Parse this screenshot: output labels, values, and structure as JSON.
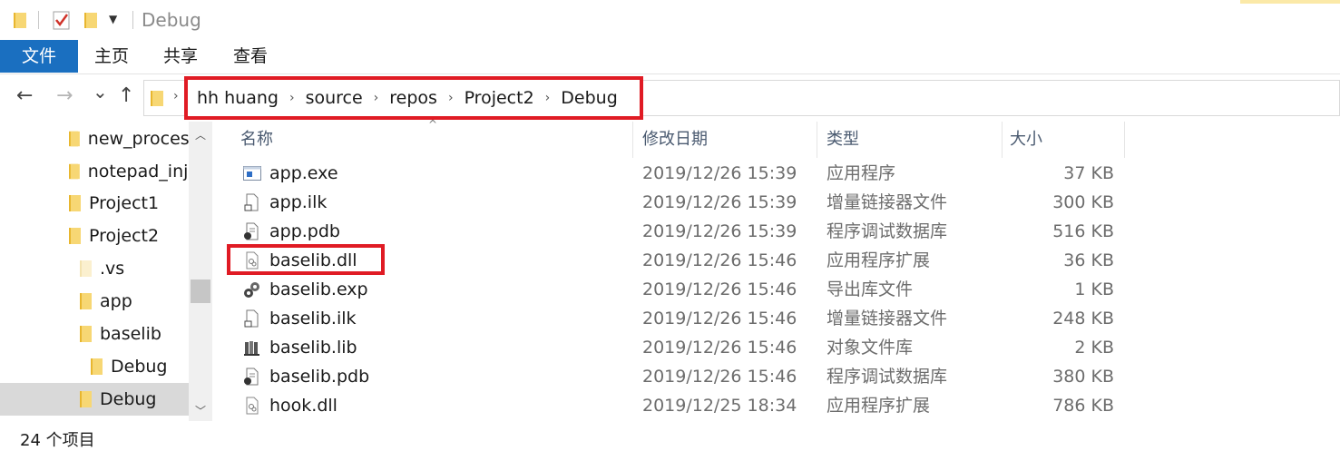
{
  "window": {
    "title": "Debug",
    "quick_access_icons": [
      "folder-icon",
      "properties-check-icon",
      "new-folder-icon",
      "customize-dropdown-icon"
    ]
  },
  "ribbon": {
    "tabs": [
      "文件",
      "主页",
      "共享",
      "查看"
    ],
    "active_tab_color": "#1a6fc0"
  },
  "nav": {
    "back": "←",
    "forward": "→",
    "recent": "⌄",
    "up": "↑",
    "breadcrumbs": [
      "hh huang",
      "source",
      "repos",
      "Project2",
      "Debug"
    ],
    "highlight_color": "#e01b24"
  },
  "tree": {
    "items": [
      {
        "label": "new_process"
      },
      {
        "label": "notepad_inje"
      },
      {
        "label": "Project1"
      },
      {
        "label": "Project2"
      },
      {
        "label": ".vs"
      },
      {
        "label": "app"
      },
      {
        "label": "baselib"
      },
      {
        "label": "Debug"
      },
      {
        "label": "Debug"
      }
    ],
    "selected_index": 8
  },
  "columns": {
    "name": "名称",
    "date": "修改日期",
    "type": "类型",
    "size": "大小"
  },
  "files": [
    {
      "name": "app.exe",
      "date": "2019/12/26 15:39",
      "type": "应用程序",
      "size": "37 KB",
      "icon": "exe-icon"
    },
    {
      "name": "app.ilk",
      "date": "2019/12/26 15:39",
      "type": "增量链接器文件",
      "size": "300 KB",
      "icon": "ilk-file-icon"
    },
    {
      "name": "app.pdb",
      "date": "2019/12/26 15:39",
      "type": "程序调试数据库",
      "size": "516 KB",
      "icon": "pdb-file-icon"
    },
    {
      "name": "baselib.dll",
      "date": "2019/12/26 15:46",
      "type": "应用程序扩展",
      "size": "36 KB",
      "icon": "dll-file-icon"
    },
    {
      "name": "baselib.exp",
      "date": "2019/12/26 15:46",
      "type": "导出库文件",
      "size": "1 KB",
      "icon": "exp-file-icon"
    },
    {
      "name": "baselib.ilk",
      "date": "2019/12/26 15:46",
      "type": "增量链接器文件",
      "size": "248 KB",
      "icon": "ilk-file-icon"
    },
    {
      "name": "baselib.lib",
      "date": "2019/12/26 15:46",
      "type": "对象文件库",
      "size": "2 KB",
      "icon": "lib-file-icon"
    },
    {
      "name": "baselib.pdb",
      "date": "2019/12/26 15:46",
      "type": "程序调试数据库",
      "size": "380 KB",
      "icon": "pdb-file-icon"
    },
    {
      "name": "hook.dll",
      "date": "2019/12/25 18:34",
      "type": "应用程序扩展",
      "size": "786 KB",
      "icon": "dll-file-icon"
    }
  ],
  "highlighted_file_index": 3,
  "status": {
    "item_count": "24 个项目"
  }
}
